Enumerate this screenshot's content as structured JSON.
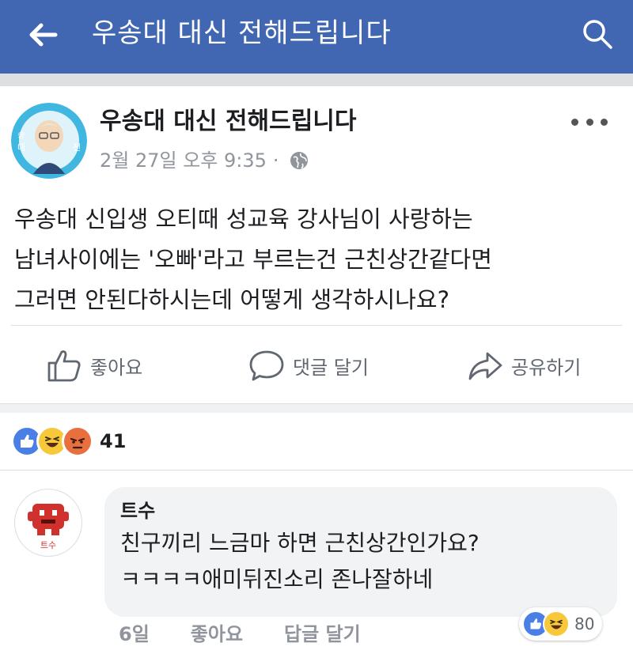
{
  "header": {
    "title": "우송대 대신 전해드립니다",
    "back_icon": "back-arrow-icon",
    "search_icon": "search-icon",
    "background": "#4267b2"
  },
  "post": {
    "author": "우송대 대신 전해드립니다",
    "timestamp": "2월 27일 오후 9:35",
    "separator": "·",
    "privacy_icon": "globe-icon",
    "text_lines": [
      "우송대 신입생 오티때 성교육 강사님이 사랑하는",
      "남녀사이에는 '오빠'라고 부르는건 근친상간같다면",
      "그러면 안된다하시는데 어떻게 생각하시나요?"
    ],
    "actions": {
      "like": "좋아요",
      "comment": "댓글 달기",
      "share": "공유하기"
    },
    "reactions": {
      "types": [
        "like",
        "haha",
        "angry"
      ],
      "count": "41"
    }
  },
  "comment": {
    "author": "트수",
    "avatar_tag": "트수",
    "lines": [
      "친구끼리 느금마 하면 근친상간인가요?",
      "ㅋㅋㅋㅋ애미뒤진소리 존나잘하네"
    ],
    "time": "6일",
    "like": "좋아요",
    "reply": "답글 달기",
    "reactions": {
      "types": [
        "like",
        "haha"
      ],
      "count": "80"
    }
  }
}
